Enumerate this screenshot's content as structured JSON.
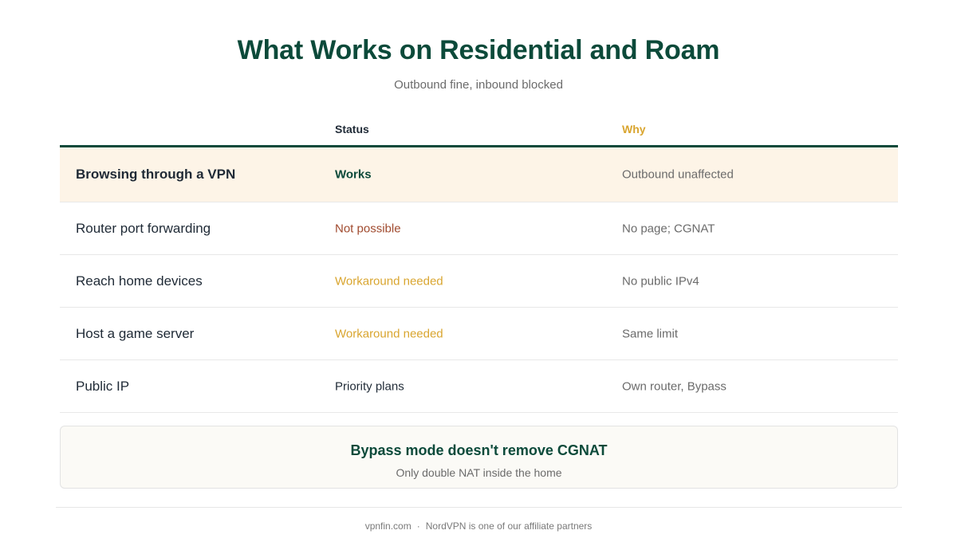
{
  "header": {
    "title": "What Works on Residential and Roam",
    "subtitle": "Outbound fine, inbound blocked"
  },
  "table": {
    "columns": {
      "feature": "",
      "status": "Status",
      "why": "Why"
    },
    "rows": [
      {
        "feature": "Browsing through a VPN",
        "status": "Works",
        "why": "Outbound unaffected"
      },
      {
        "feature": "Router port forwarding",
        "status": "Not possible",
        "why": "No page; CGNAT"
      },
      {
        "feature": "Reach home devices",
        "status": "Workaround needed",
        "why": "No public IPv4"
      },
      {
        "feature": "Host a game server",
        "status": "Workaround needed",
        "why": "Same limit"
      },
      {
        "feature": "Public IP",
        "status": "Priority plans",
        "why": "Own router, Bypass"
      }
    ]
  },
  "callout": {
    "title": "Bypass mode doesn't remove CGNAT",
    "text": "Only double NAT inside the home"
  },
  "footer": {
    "site": "vpnfin.com",
    "separator": "·",
    "note": "NordVPN is one of our affiliate partners"
  },
  "colors": {
    "primary": "#0c4a3a",
    "accent": "#d9a52f",
    "negative": "#a04a2e",
    "highlight_bg": "#fdf4e7"
  }
}
